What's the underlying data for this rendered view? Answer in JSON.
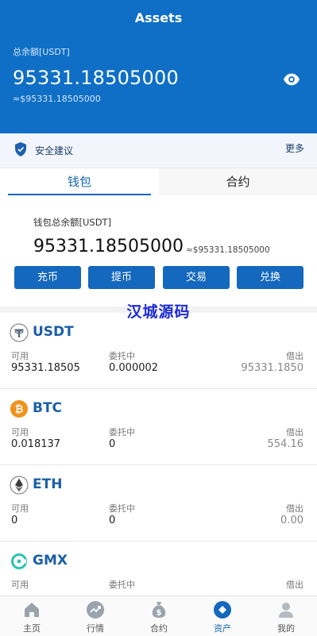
{
  "header": {
    "title": "Assets",
    "total_label": "总余额[USDT]",
    "total_value": "95331.18505000",
    "total_approx": "≈$95331.18505000",
    "eye_icon": "eye-icon"
  },
  "advice": {
    "label": "安全建议",
    "more": "更多",
    "icon": "shield-icon"
  },
  "tabs": {
    "wallet": "钱包",
    "contract": "合约",
    "active": "wallet"
  },
  "wallet": {
    "label": "钱包总余额[USDT]",
    "value": "95331.18505000",
    "approx": "≈$95331.18505000"
  },
  "actions": {
    "deposit": "充币",
    "withdraw": "提币",
    "trade": "交易",
    "exchange": "兑换"
  },
  "watermark": "汉城源码",
  "coins": [
    {
      "symbol": "USDT",
      "icon": "tether-icon",
      "available_label": "可用",
      "available": "95331.18505",
      "entrusted_label": "委托中",
      "entrusted": "0.000002",
      "borrowed_label": "借出",
      "borrowed": "95331.1850"
    },
    {
      "symbol": "BTC",
      "icon": "bitcoin-icon",
      "available_label": "可用",
      "available": "0.018137",
      "entrusted_label": "委托中",
      "entrusted": "0",
      "borrowed_label": "借出",
      "borrowed": "554.16"
    },
    {
      "symbol": "ETH",
      "icon": "ethereum-icon",
      "available_label": "可用",
      "available": "0",
      "entrusted_label": "委托中",
      "entrusted": "0",
      "borrowed_label": "借出",
      "borrowed": "0.00"
    },
    {
      "symbol": "GMX",
      "icon": "gmx-icon",
      "available_label": "可用",
      "available": "",
      "entrusted_label": "委托中",
      "entrusted": "",
      "borrowed_label": "借出",
      "borrowed": ""
    }
  ],
  "tabbar": {
    "home": "主页",
    "market": "行情",
    "contract": "合约",
    "assets": "资产",
    "mine": "我的",
    "active": "assets"
  },
  "colors": {
    "brand": "#0f6fc6",
    "button": "#1468bd",
    "coin_name": "#1b5fa6",
    "watermark": "#1b2bd6"
  }
}
